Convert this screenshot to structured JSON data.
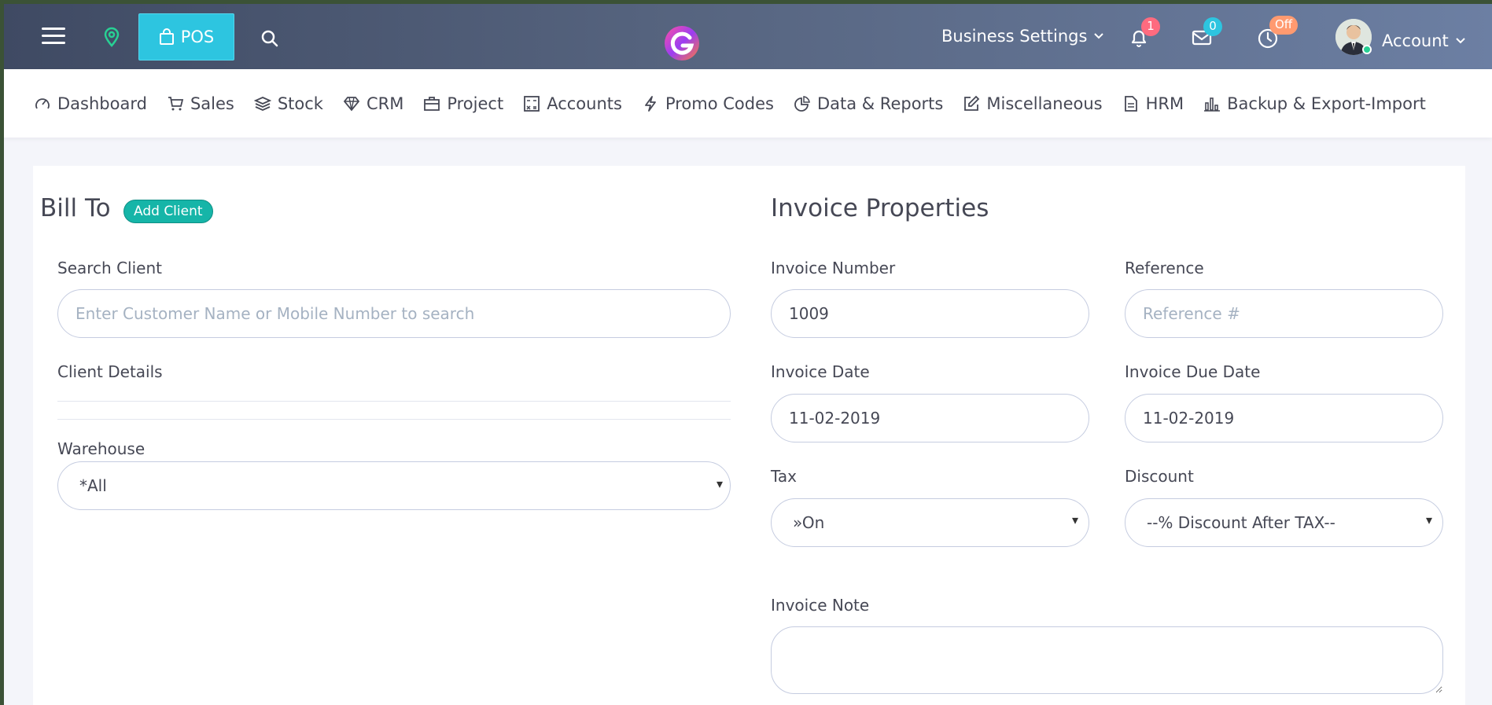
{
  "topbar": {
    "pos_label": "POS",
    "business_settings": "Business Settings",
    "notifications_count": "1",
    "messages_count": "0",
    "timer_status": "Off",
    "account_label": "Account"
  },
  "menu": [
    {
      "label": "Dashboard",
      "icon": "dashboard-icon"
    },
    {
      "label": "Sales",
      "icon": "cart-icon"
    },
    {
      "label": "Stock",
      "icon": "layers-icon"
    },
    {
      "label": "CRM",
      "icon": "diamond-icon"
    },
    {
      "label": "Project",
      "icon": "briefcase-icon"
    },
    {
      "label": "Accounts",
      "icon": "calculator-icon"
    },
    {
      "label": "Promo Codes",
      "icon": "bolt-icon"
    },
    {
      "label": "Data & Reports",
      "icon": "pie-chart-icon"
    },
    {
      "label": "Miscellaneous",
      "icon": "edit-icon"
    },
    {
      "label": "HRM",
      "icon": "document-icon"
    },
    {
      "label": "Backup & Export-Import",
      "icon": "bar-chart-icon"
    }
  ],
  "bill_to": {
    "title": "Bill To",
    "add_client": "Add Client",
    "search_label": "Search Client",
    "search_placeholder": "Enter Customer Name or Mobile Number to search",
    "client_details_label": "Client Details",
    "warehouse_label": "Warehouse",
    "warehouse_value": "*All"
  },
  "invoice": {
    "title": "Invoice Properties",
    "number_label": "Invoice Number",
    "number_value": "1009",
    "reference_label": "Reference",
    "reference_placeholder": "Reference #",
    "date_label": "Invoice Date",
    "date_value": "11-02-2019",
    "due_label": "Invoice Due Date",
    "due_value": "11-02-2019",
    "tax_label": "Tax",
    "tax_value": "»On",
    "discount_label": "Discount",
    "discount_value": "--% Discount After TAX--",
    "note_label": "Invoice Note"
  },
  "colors": {
    "pos_button": "#2dc5e0",
    "add_client": "#16b5a8",
    "notif_badge": "#ff6b7f",
    "mail_badge": "#2dc5e0",
    "timer_badge": "#ff9a70"
  }
}
